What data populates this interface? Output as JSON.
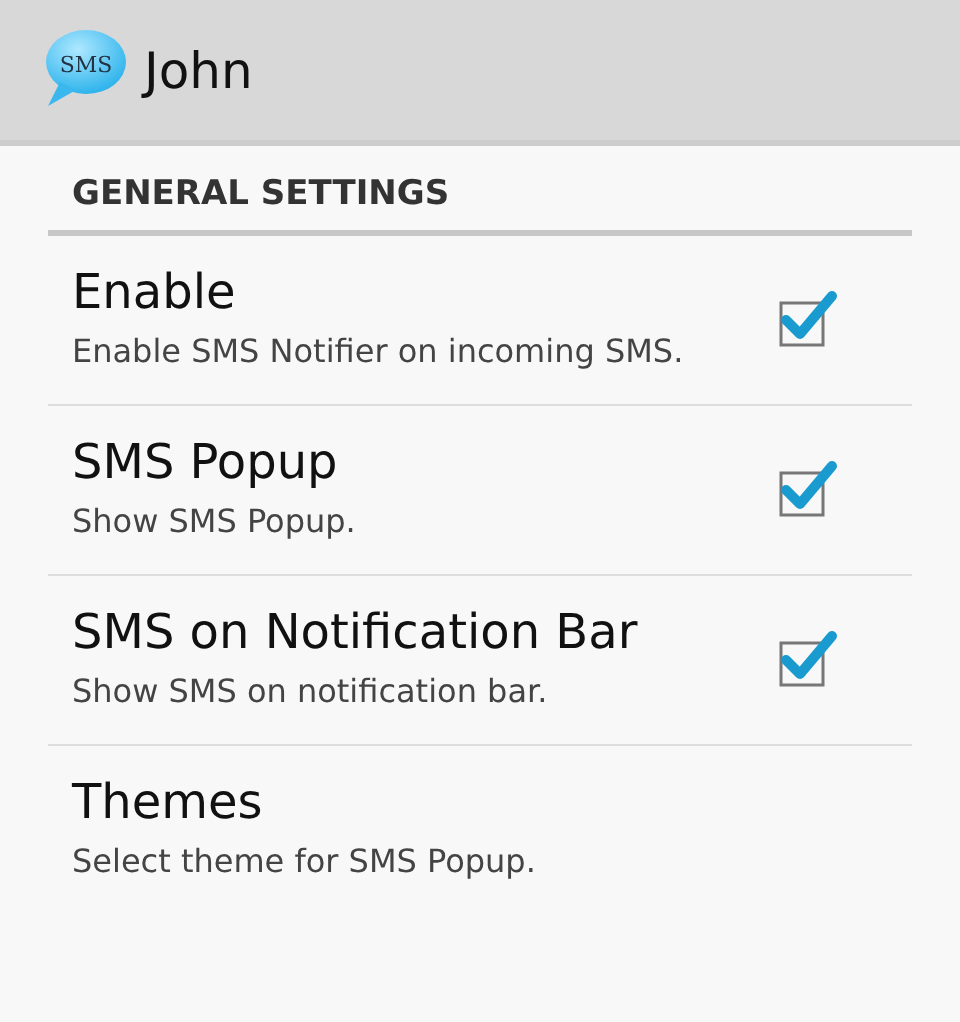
{
  "action_bar": {
    "icon_label": "SMS",
    "title": "John"
  },
  "section": {
    "title": "GENERAL SETTINGS"
  },
  "preferences": [
    {
      "kind": "checkbox",
      "title": "Enable",
      "summary": "Enable SMS Notifier on incoming SMS.",
      "checked": true
    },
    {
      "kind": "checkbox",
      "title": "SMS Popup",
      "summary": "Show SMS Popup.",
      "checked": true
    },
    {
      "kind": "checkbox",
      "title": "SMS on Notification Bar",
      "summary": "Show SMS on notification bar.",
      "checked": true
    },
    {
      "kind": "plain",
      "title": "Themes",
      "summary": "Select theme for SMS Popup."
    }
  ]
}
